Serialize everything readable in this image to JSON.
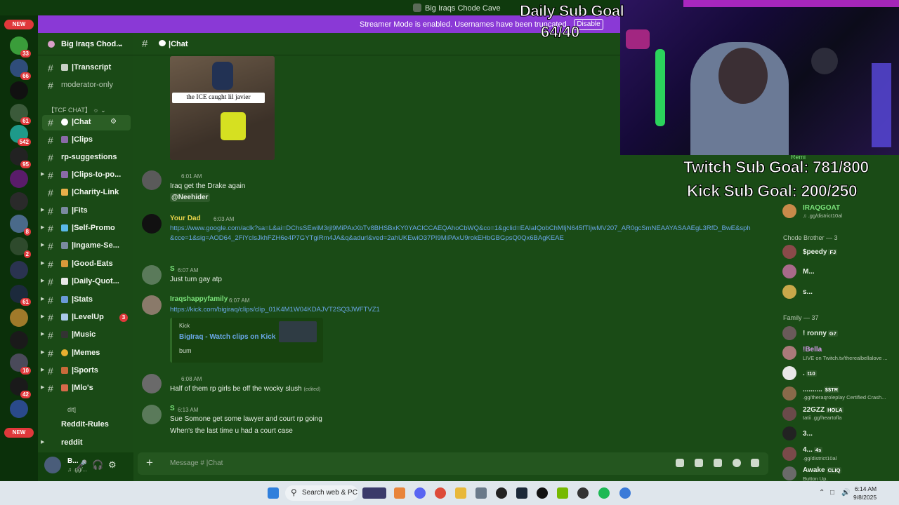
{
  "window": {
    "title": "Big Iraqs Chode Cave"
  },
  "banner": {
    "message": "Streamer Mode is enabled. Usernames have been truncated.",
    "button": "Disable"
  },
  "overlay": {
    "daily_goal": "Daily Sub Goal",
    "daily_value": "64/40",
    "twitch_goal": "Twitch Sub Goal: 781/800",
    "kick_goal": "Kick Sub Goal: 200/250"
  },
  "rail": {
    "new_top": "NEW",
    "new_bottom": "NEW",
    "badges": [
      "33",
      "66",
      "61",
      "542",
      "95",
      "8",
      "2",
      "61",
      "10",
      "42"
    ]
  },
  "server": {
    "name": "Big Iraqs Chod..."
  },
  "sidebar": {
    "category": "【TCF CHAT】",
    "channels": [
      {
        "label": "|Transcript"
      },
      {
        "label": "moderator-only"
      },
      {
        "label": "|Chat"
      },
      {
        "label": "|Clips"
      },
      {
        "label": "rp-suggestions"
      },
      {
        "label": "|Clips-to-po..."
      },
      {
        "label": "|Charity-Link"
      },
      {
        "label": "|Fits"
      },
      {
        "label": "|Self-Promo"
      },
      {
        "label": "|Ingame-Se..."
      },
      {
        "label": "|Good-Eats"
      },
      {
        "label": "|Daily-Quot..."
      },
      {
        "label": "|Stats"
      },
      {
        "label": "|LevelUp",
        "unread": "3"
      },
      {
        "label": "|Music"
      },
      {
        "label": "|Memes"
      },
      {
        "label": "|Sports"
      },
      {
        "label": "|Mlo's"
      },
      {
        "label": "dit]"
      },
      {
        "label": "Reddit-Rules"
      },
      {
        "label": "reddit"
      }
    ]
  },
  "user_panel": {
    "name": "B...",
    "status": "♫ .gg/..."
  },
  "chat": {
    "channel": "|Chat",
    "image_caption": "the ICE caught lil javier",
    "messages": [
      {
        "author": "",
        "time": "6:01 AM",
        "text": "Iraq get the Drake again",
        "mention": "@Neehider"
      },
      {
        "author": "Your Dad",
        "time": "6:03 AM",
        "link": "https://www.google.com/aclk?sa=L&ai=DChsSEwiM3rjl9MiPAxXbTv8BHSBxKY0YACICCAEQAhoCbWQ&co=1&gclid=EAIaIQobChMIjN645fTIjwMV207_AR0gcSmNEAAYASAAEgL3RfD_BwE&sph&cce=1&sig=AOD64_2FiYcIsJkhFZH6e4P7GYTgiRm4JA&q&adurl&ved=2ahUKEwiO37PI9MiPAxU9rokEHbGBGpsQ0Qx6BAgKEAE"
      },
      {
        "author": "S",
        "time": "6:07 AM",
        "text": "Just turn gay atp"
      },
      {
        "author": "Iraqshappyfamily",
        "time": "6:07 AM",
        "link": "https://kick.com/bigiraq/clips/clip_01K4M1W04KDAJVT2SQ3JWFTVZ1"
      },
      {
        "author": "",
        "time": "6:08 AM",
        "text": "Half of them rp girls be off the wocky slush",
        "edited": "(edited)"
      },
      {
        "author": "S",
        "time": "6:13 AM",
        "text": "Sue Somone get some lawyer and court rp going",
        "text2": "When's the last time u had a court case"
      }
    ],
    "embed": {
      "provider": "Kick",
      "title": "BigIraq - Watch clips on Kick",
      "description": "bum"
    },
    "composer_placeholder": "Message #  |Chat"
  },
  "members": {
    "top": {
      "status_top": "Remi",
      "name": "IRAQGOAT",
      "status": "♫ .gg/district10al"
    },
    "groups": [
      {
        "header": "Chode Brother — 3",
        "members": [
          {
            "name": "$peedy",
            "tag": "FJ"
          },
          {
            "name": "M..."
          },
          {
            "name": "s..."
          }
        ]
      },
      {
        "header": "Family — 37",
        "members": [
          {
            "name": "! ronny",
            "tag": "G7"
          },
          {
            "name": "!Bella",
            "status": "LIVE on Twitch.tv/therealbellalove ..."
          },
          {
            "name": ".",
            "tag": "t10"
          },
          {
            "name": "..........",
            "tag": "$$TR",
            "status": ".gg/theraqroleplay Certified Crash..."
          },
          {
            "name": "22GZZ",
            "tag": "HOLA",
            "status": "tatii .gg/heartofla"
          },
          {
            "name": "3..."
          },
          {
            "name": "4...",
            "tag": "4s",
            "status": ".gg/district10al"
          },
          {
            "name": "Awake",
            "tag": "CLIQ",
            "status": "Button Up."
          }
        ]
      }
    ]
  },
  "taskbar": {
    "search": "Search web & PC",
    "time": "6:14 AM",
    "date": "9/8/2025"
  },
  "colors": {
    "discord_green": "#1a4b16",
    "banner_purple": "#8a39d6",
    "link": "#6aa7e6",
    "badge_red": "#e0383b"
  }
}
